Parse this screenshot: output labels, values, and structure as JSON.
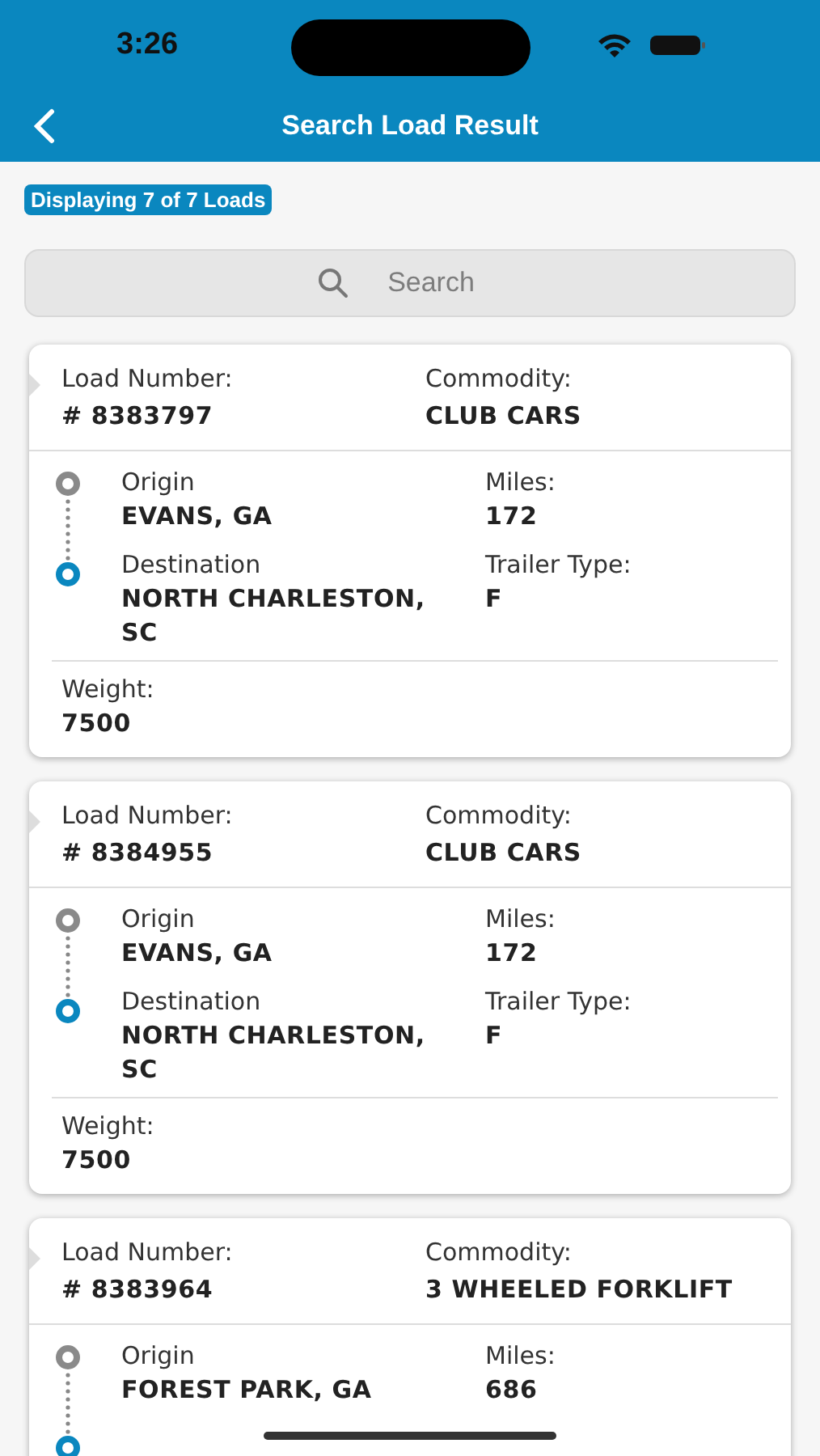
{
  "status_bar": {
    "time": "3:26"
  },
  "header": {
    "title": "Search Load Result"
  },
  "count_badge": "Displaying 7 of 7 Loads",
  "search": {
    "placeholder": "Search"
  },
  "loads": [
    {
      "load_label": "Load Number:",
      "load_number": "# 8383797",
      "commodity_label": "Commodity:",
      "commodity": "CLUB CARS",
      "origin_label": "Origin",
      "origin": "EVANS, GA",
      "miles_label": "Miles:",
      "miles": "172",
      "destination_label": "Destination",
      "destination": "NORTH CHARLESTON, SC",
      "trailer_label": "Trailer Type:",
      "trailer": "F",
      "weight_label": "Weight:",
      "weight": "7500"
    },
    {
      "load_label": "Load Number:",
      "load_number": "# 8384955",
      "commodity_label": "Commodity:",
      "commodity": "CLUB CARS",
      "origin_label": "Origin",
      "origin": "EVANS, GA",
      "miles_label": "Miles:",
      "miles": "172",
      "destination_label": "Destination",
      "destination": "NORTH CHARLESTON, SC",
      "trailer_label": "Trailer Type:",
      "trailer": "F",
      "weight_label": "Weight:",
      "weight": "7500"
    },
    {
      "load_label": "Load Number:",
      "load_number": "# 8383964",
      "commodity_label": "Commodity:",
      "commodity": "3 WHEELED FORKLIFT",
      "origin_label": "Origin",
      "origin": "FOREST PARK, GA",
      "miles_label": "Miles:",
      "miles": "686"
    }
  ]
}
